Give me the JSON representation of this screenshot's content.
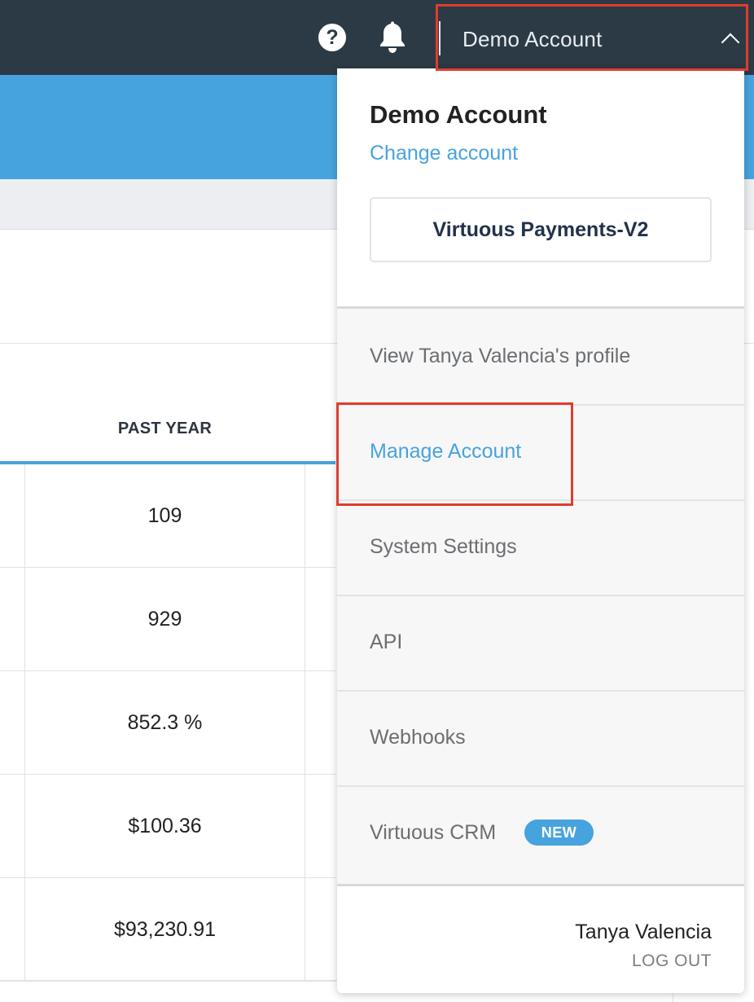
{
  "topbar": {
    "help_icon": "help-circle-icon",
    "help_glyph": "?",
    "bell_icon": "bell-icon",
    "account_label": "Demo Account",
    "account_toggle_icon": "chevron-up-icon"
  },
  "table": {
    "column_header": "PAST YEAR",
    "rows": [
      "109",
      "929",
      "852.3 %",
      "$100.36",
      "$93,230.91"
    ]
  },
  "dropdown": {
    "account_title": "Demo Account",
    "change_account": "Change account",
    "org_button": "Virtuous Payments-V2",
    "items": [
      {
        "label": "View Tanya Valencia's profile"
      },
      {
        "label": "Manage Account",
        "active": true
      },
      {
        "label": "System Settings"
      },
      {
        "label": "API"
      },
      {
        "label": "Webhooks"
      },
      {
        "label": "Virtuous CRM",
        "badge": "NEW"
      }
    ],
    "user_name": "Tanya Valencia",
    "logout": "LOG OUT"
  },
  "colors": {
    "topbar": "#2c3a46",
    "accent": "#47a3dd",
    "highlight": "#e03c2e"
  }
}
